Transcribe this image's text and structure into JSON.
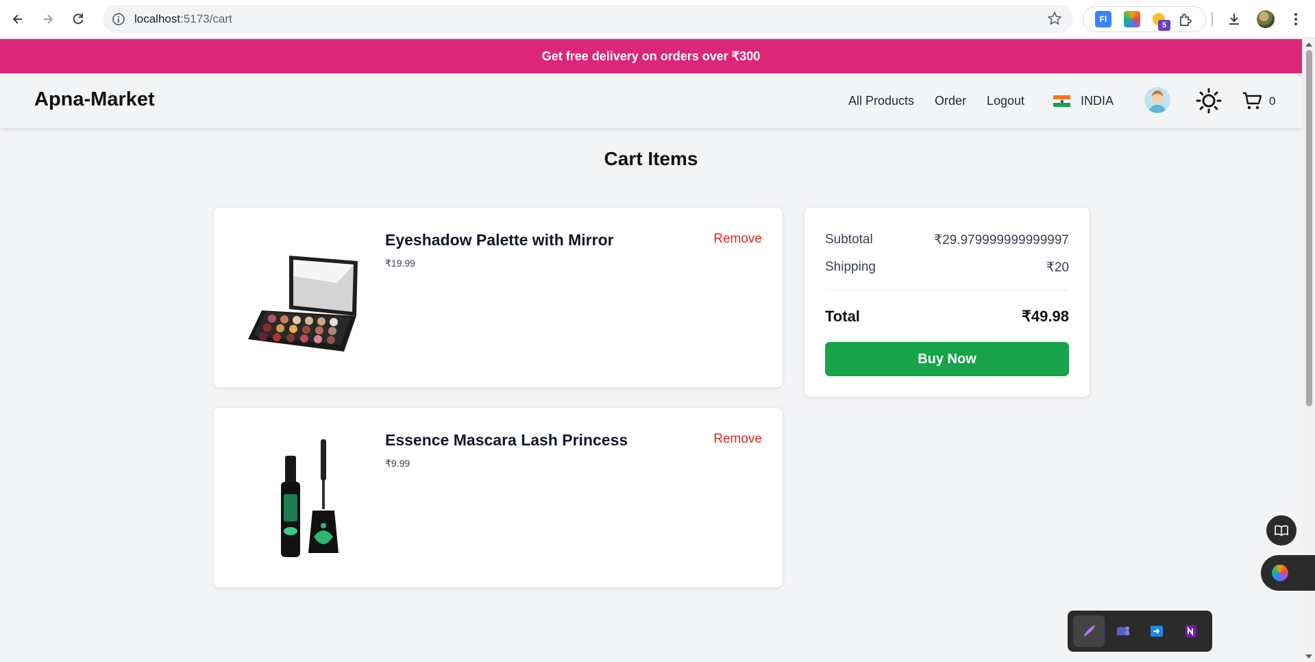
{
  "browser": {
    "url_host": "localhost",
    "url_path": ":5173/cart",
    "extension_badge": "5",
    "ext_label_1": "Fl"
  },
  "promo": {
    "text": "Get free delivery on orders over ₹300"
  },
  "header": {
    "brand": "Apna-Market",
    "nav": [
      "All Products",
      "Order",
      "Logout"
    ],
    "country": "INDIA",
    "cart_count": "0"
  },
  "page": {
    "title": "Cart Items"
  },
  "cart_items": [
    {
      "name": "Eyeshadow Palette with Mirror",
      "price": "₹19.99",
      "remove_label": "Remove"
    },
    {
      "name": "Essence Mascara Lash Princess",
      "price": "₹9.99",
      "remove_label": "Remove"
    }
  ],
  "summary": {
    "subtotal_label": "Subtotal",
    "subtotal_value": "₹29.979999999999997",
    "shipping_label": "Shipping",
    "shipping_value": "₹20",
    "total_label": "Total",
    "total_value": "₹49.98",
    "buy_label": "Buy Now"
  },
  "colors": {
    "promo_bg": "#db2777",
    "buy_button": "#16a34a",
    "remove_text": "#dc2626"
  },
  "icons": [
    "back-icon",
    "forward-icon",
    "reload-icon",
    "site-info-icon",
    "star-icon",
    "extensions-icon",
    "download-icon",
    "menu-icon",
    "sun-icon",
    "cart-icon",
    "book-icon"
  ]
}
